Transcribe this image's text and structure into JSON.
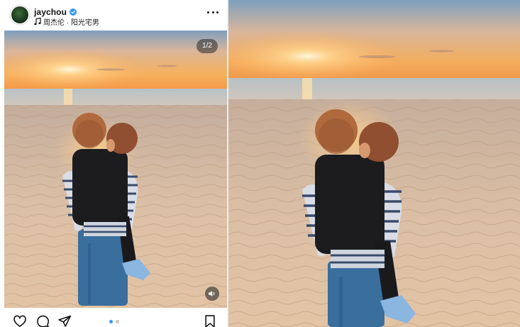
{
  "post": {
    "username": "jaychou",
    "verified": true,
    "music": "周杰伦 · 阳光宅男",
    "image_counter": "1/2",
    "carousel": {
      "total": 2,
      "active": 1
    }
  },
  "icons": {
    "more": "more-options-icon",
    "like": "heart-icon",
    "comment": "comment-icon",
    "share": "send-icon",
    "save": "bookmark-icon",
    "sound": "speaker-icon",
    "music": "music-note-icon",
    "verified": "verified-badge-icon"
  },
  "colors": {
    "verified_blue": "#3897f0",
    "sky_top": "#7ea0bf",
    "sunset_orange": "#f2a64f",
    "sand": "#d8b89a"
  }
}
